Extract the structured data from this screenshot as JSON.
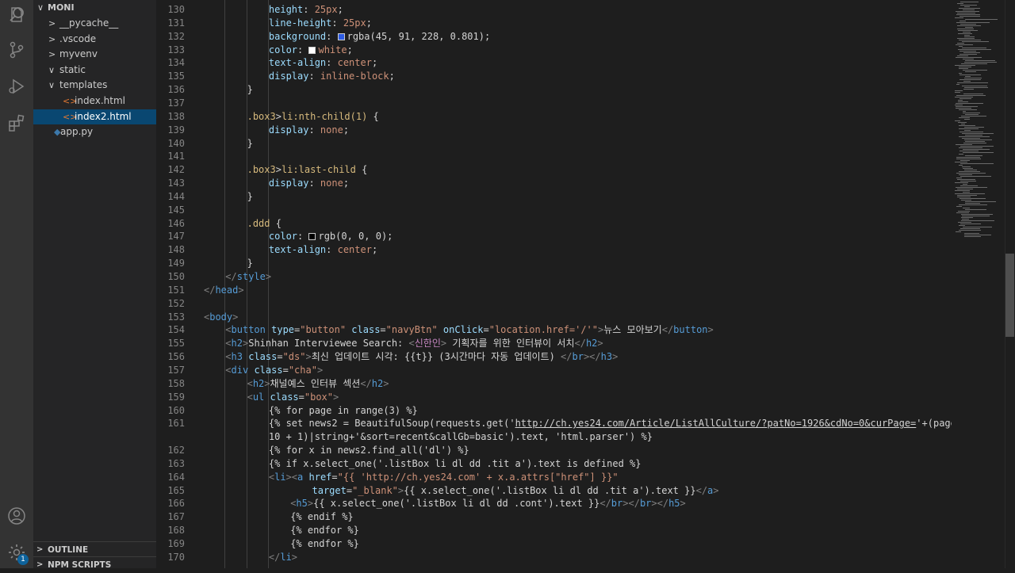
{
  "explorer": {
    "root": "MONI",
    "items": [
      {
        "label": "__pycache__",
        "kind": "folder",
        "open": false
      },
      {
        "label": ".vscode",
        "kind": "folder",
        "open": false
      },
      {
        "label": "myvenv",
        "kind": "folder",
        "open": false
      },
      {
        "label": "static",
        "kind": "folder",
        "open": true
      },
      {
        "label": "templates",
        "kind": "folder",
        "open": true
      },
      {
        "label": "index.html",
        "kind": "html-file",
        "icon": "<>"
      },
      {
        "label": "index2.html",
        "kind": "html-file",
        "icon": "<>",
        "selected": true
      },
      {
        "label": "app.py",
        "kind": "python-file"
      }
    ],
    "sections": [
      "OUTLINE",
      "NPM SCRIPTS"
    ]
  },
  "activity": {
    "icons": [
      "explorer-icon",
      "search-icon",
      "source-control-icon",
      "run-debug-icon",
      "extensions-icon",
      "account-icon",
      "settings-gear-icon"
    ],
    "settings_badge": "1"
  },
  "editor": {
    "lines": [
      {
        "n": "130",
        "indent": 3,
        "tokens": [
          {
            "c": "t-prop",
            "t": "height"
          },
          {
            "c": "t-txt",
            "t": ": "
          },
          {
            "c": "t-val",
            "t": "25px"
          },
          {
            "c": "t-txt",
            "t": ";"
          }
        ]
      },
      {
        "n": "131",
        "indent": 3,
        "tokens": [
          {
            "c": "t-prop",
            "t": "line-height"
          },
          {
            "c": "t-txt",
            "t": ": "
          },
          {
            "c": "t-val",
            "t": "25px"
          },
          {
            "c": "t-txt",
            "t": ";"
          }
        ]
      },
      {
        "n": "132",
        "indent": 3,
        "tokens": [
          {
            "c": "t-prop",
            "t": "background"
          },
          {
            "c": "t-txt",
            "t": ": "
          },
          {
            "swatch": "#2d5be4"
          },
          {
            "c": "t-txt",
            "t": "rgba(45, 91, 228, 0.801)"
          },
          {
            "c": "t-txt",
            "t": ";"
          }
        ]
      },
      {
        "n": "133",
        "indent": 3,
        "tokens": [
          {
            "c": "t-prop",
            "t": "color"
          },
          {
            "c": "t-txt",
            "t": ": "
          },
          {
            "swatch": "#ffffff"
          },
          {
            "c": "t-val",
            "t": "white"
          },
          {
            "c": "t-txt",
            "t": ";"
          }
        ]
      },
      {
        "n": "134",
        "indent": 3,
        "tokens": [
          {
            "c": "t-prop",
            "t": "text-align"
          },
          {
            "c": "t-txt",
            "t": ": "
          },
          {
            "c": "t-val",
            "t": "center"
          },
          {
            "c": "t-txt",
            "t": ";"
          }
        ]
      },
      {
        "n": "135",
        "indent": 3,
        "tokens": [
          {
            "c": "t-prop",
            "t": "display"
          },
          {
            "c": "t-txt",
            "t": ": "
          },
          {
            "c": "t-val",
            "t": "inline-block"
          },
          {
            "c": "t-txt",
            "t": ";"
          }
        ]
      },
      {
        "n": "136",
        "indent": 2,
        "tokens": [
          {
            "c": "t-txt",
            "t": "}"
          }
        ]
      },
      {
        "n": "137",
        "indent": 0,
        "tokens": []
      },
      {
        "n": "138",
        "indent": 2,
        "tokens": [
          {
            "c": "t-sel",
            "t": ".box3"
          },
          {
            "c": "t-txt",
            "t": ">"
          },
          {
            "c": "t-sel",
            "t": "li:nth-child(1)"
          },
          {
            "c": "t-txt",
            "t": " {"
          }
        ]
      },
      {
        "n": "139",
        "indent": 3,
        "tokens": [
          {
            "c": "t-prop",
            "t": "display"
          },
          {
            "c": "t-txt",
            "t": ": "
          },
          {
            "c": "t-val",
            "t": "none"
          },
          {
            "c": "t-txt",
            "t": ";"
          }
        ]
      },
      {
        "n": "140",
        "indent": 2,
        "tokens": [
          {
            "c": "t-txt",
            "t": "}"
          }
        ]
      },
      {
        "n": "141",
        "indent": 0,
        "tokens": []
      },
      {
        "n": "142",
        "indent": 2,
        "tokens": [
          {
            "c": "t-sel",
            "t": ".box3"
          },
          {
            "c": "t-txt",
            "t": ">"
          },
          {
            "c": "t-sel",
            "t": "li:last-child"
          },
          {
            "c": "t-txt",
            "t": " {"
          }
        ]
      },
      {
        "n": "143",
        "indent": 3,
        "tokens": [
          {
            "c": "t-prop",
            "t": "display"
          },
          {
            "c": "t-txt",
            "t": ": "
          },
          {
            "c": "t-val",
            "t": "none"
          },
          {
            "c": "t-txt",
            "t": ";"
          }
        ]
      },
      {
        "n": "144",
        "indent": 2,
        "tokens": [
          {
            "c": "t-txt",
            "t": "}"
          }
        ]
      },
      {
        "n": "145",
        "indent": 0,
        "tokens": []
      },
      {
        "n": "146",
        "indent": 2,
        "tokens": [
          {
            "c": "t-sel",
            "t": ".ddd"
          },
          {
            "c": "t-txt",
            "t": " {"
          }
        ]
      },
      {
        "n": "147",
        "indent": 3,
        "tokens": [
          {
            "c": "t-prop",
            "t": "color"
          },
          {
            "c": "t-txt",
            "t": ": "
          },
          {
            "swatch": "#000000"
          },
          {
            "c": "t-txt",
            "t": "rgb(0, 0, 0)"
          },
          {
            "c": "t-txt",
            "t": ";"
          }
        ]
      },
      {
        "n": "148",
        "indent": 3,
        "tokens": [
          {
            "c": "t-prop",
            "t": "text-align"
          },
          {
            "c": "t-txt",
            "t": ": "
          },
          {
            "c": "t-val",
            "t": "center"
          },
          {
            "c": "t-txt",
            "t": ";"
          }
        ]
      },
      {
        "n": "149",
        "indent": 2,
        "tokens": [
          {
            "c": "t-txt",
            "t": "}"
          }
        ]
      },
      {
        "n": "150",
        "indent": 1,
        "tokens": [
          {
            "c": "t-punc",
            "t": "</"
          },
          {
            "c": "t-tag",
            "t": "style"
          },
          {
            "c": "t-punc",
            "t": ">"
          }
        ]
      },
      {
        "n": "151",
        "indent": 0,
        "tokens": [
          {
            "c": "t-punc",
            "t": "</"
          },
          {
            "c": "t-tag",
            "t": "head"
          },
          {
            "c": "t-punc",
            "t": ">"
          }
        ]
      },
      {
        "n": "152",
        "indent": 0,
        "tokens": []
      },
      {
        "n": "153",
        "indent": 0,
        "tokens": [
          {
            "c": "t-punc",
            "t": "<"
          },
          {
            "c": "t-tag",
            "t": "body"
          },
          {
            "c": "t-punc",
            "t": ">"
          }
        ]
      },
      {
        "n": "154",
        "indent": 1,
        "tokens": [
          {
            "c": "t-punc",
            "t": "<"
          },
          {
            "c": "t-tag",
            "t": "button"
          },
          {
            "c": "t-txt",
            "t": " "
          },
          {
            "c": "t-attr",
            "t": "type"
          },
          {
            "c": "t-txt",
            "t": "="
          },
          {
            "c": "t-str",
            "t": "\"button\""
          },
          {
            "c": "t-txt",
            "t": " "
          },
          {
            "c": "t-attr",
            "t": "class"
          },
          {
            "c": "t-txt",
            "t": "="
          },
          {
            "c": "t-str",
            "t": "\"navyBtn\""
          },
          {
            "c": "t-txt",
            "t": " "
          },
          {
            "c": "t-attr",
            "t": "onClick"
          },
          {
            "c": "t-txt",
            "t": "="
          },
          {
            "c": "t-str",
            "t": "\"location.href='/'\""
          },
          {
            "c": "t-punc",
            "t": ">"
          },
          {
            "c": "t-txt",
            "t": "뉴스 모아보기"
          },
          {
            "c": "t-punc",
            "t": "</"
          },
          {
            "c": "t-tag",
            "t": "button"
          },
          {
            "c": "t-punc",
            "t": ">"
          }
        ]
      },
      {
        "n": "155",
        "indent": 1,
        "tokens": [
          {
            "c": "t-punc",
            "t": "<"
          },
          {
            "c": "t-tag",
            "t": "h2"
          },
          {
            "c": "t-punc",
            "t": ">"
          },
          {
            "c": "t-txt",
            "t": "Shinhan Interviewee Search: "
          },
          {
            "c": "t-punc",
            "t": "<"
          },
          {
            "c": "t-kw",
            "t": "신한인"
          },
          {
            "c": "t-punc",
            "t": ">"
          },
          {
            "c": "t-txt",
            "t": " 기획자를 위한 인터뷰이 서치"
          },
          {
            "c": "t-punc",
            "t": "</"
          },
          {
            "c": "t-tag",
            "t": "h2"
          },
          {
            "c": "t-punc",
            "t": ">"
          }
        ]
      },
      {
        "n": "156",
        "indent": 1,
        "tokens": [
          {
            "c": "t-punc",
            "t": "<"
          },
          {
            "c": "t-tag",
            "t": "h3"
          },
          {
            "c": "t-txt",
            "t": " "
          },
          {
            "c": "t-attr",
            "t": "class"
          },
          {
            "c": "t-txt",
            "t": "="
          },
          {
            "c": "t-str",
            "t": "\"ds\""
          },
          {
            "c": "t-punc",
            "t": ">"
          },
          {
            "c": "t-txt",
            "t": "최신 업데이트 시각: {{t}} (3시간마다 자동 업데이트) "
          },
          {
            "c": "t-punc",
            "t": "</"
          },
          {
            "c": "t-tag",
            "t": "br"
          },
          {
            "c": "t-punc",
            "t": "></"
          },
          {
            "c": "t-tag",
            "t": "h3"
          },
          {
            "c": "t-punc",
            "t": ">"
          }
        ]
      },
      {
        "n": "157",
        "indent": 1,
        "tokens": [
          {
            "c": "t-punc",
            "t": "<"
          },
          {
            "c": "t-tag",
            "t": "div"
          },
          {
            "c": "t-txt",
            "t": " "
          },
          {
            "c": "t-attr",
            "t": "class"
          },
          {
            "c": "t-txt",
            "t": "="
          },
          {
            "c": "t-str",
            "t": "\"cha\""
          },
          {
            "c": "t-punc",
            "t": ">"
          }
        ]
      },
      {
        "n": "158",
        "indent": 2,
        "tokens": [
          {
            "c": "t-punc",
            "t": "<"
          },
          {
            "c": "t-tag",
            "t": "h2"
          },
          {
            "c": "t-punc",
            "t": ">"
          },
          {
            "c": "t-txt",
            "t": "채널예스 인터뷰 섹션"
          },
          {
            "c": "t-punc",
            "t": "</"
          },
          {
            "c": "t-tag",
            "t": "h2"
          },
          {
            "c": "t-punc",
            "t": ">"
          }
        ]
      },
      {
        "n": "159",
        "indent": 2,
        "tokens": [
          {
            "c": "t-punc",
            "t": "<"
          },
          {
            "c": "t-tag",
            "t": "ul"
          },
          {
            "c": "t-txt",
            "t": " "
          },
          {
            "c": "t-attr",
            "t": "class"
          },
          {
            "c": "t-txt",
            "t": "="
          },
          {
            "c": "t-str",
            "t": "\"box\""
          },
          {
            "c": "t-punc",
            "t": ">"
          }
        ]
      },
      {
        "n": "160",
        "indent": 3,
        "tokens": [
          {
            "c": "t-txt",
            "t": "{% for page in range(3) %}"
          }
        ]
      },
      {
        "n": "161",
        "indent": 3,
        "tokens": [
          {
            "c": "t-txt",
            "t": "{% set news2 = BeautifulSoup(requests.get('"
          },
          {
            "c": "t-txt",
            "t": "http://ch.yes24.com/Article/ListAllCulture/?patNo=1926&cdNo=0&curPage=",
            "link": true
          },
          {
            "c": "t-txt",
            "t": "'+(page *"
          }
        ]
      },
      {
        "n": "",
        "indent": 3,
        "tokens": [
          {
            "c": "t-txt",
            "t": "10 + 1)|string+'&sort=recent&callGb=basic').text, 'html.parser') %}"
          }
        ]
      },
      {
        "n": "162",
        "indent": 3,
        "tokens": [
          {
            "c": "t-txt",
            "t": "{% for x in news2.find_all('dl') %}"
          }
        ]
      },
      {
        "n": "163",
        "indent": 3,
        "tokens": [
          {
            "c": "t-txt",
            "t": "{% if x.select_one('.listBox li dl dd .tit a').text is defined %}"
          }
        ]
      },
      {
        "n": "164",
        "indent": 3,
        "tokens": [
          {
            "c": "t-punc",
            "t": "<"
          },
          {
            "c": "t-tag",
            "t": "li"
          },
          {
            "c": "t-punc",
            "t": "><"
          },
          {
            "c": "t-tag",
            "t": "a"
          },
          {
            "c": "t-txt",
            "t": " "
          },
          {
            "c": "t-attr",
            "t": "href"
          },
          {
            "c": "t-txt",
            "t": "="
          },
          {
            "c": "t-str",
            "t": "\"{{ 'http://ch.yes24.com' + x.a.attrs[\"href\"] }}\""
          }
        ]
      },
      {
        "n": "165",
        "indent": 5,
        "tokens": [
          {
            "c": "t-attr",
            "t": "target"
          },
          {
            "c": "t-txt",
            "t": "="
          },
          {
            "c": "t-str",
            "t": "\"_blank\""
          },
          {
            "c": "t-punc",
            "t": ">"
          },
          {
            "c": "t-txt",
            "t": "{{ x.select_one('.listBox li dl dd .tit a').text }}"
          },
          {
            "c": "t-punc",
            "t": "</"
          },
          {
            "c": "t-tag",
            "t": "a"
          },
          {
            "c": "t-punc",
            "t": ">"
          }
        ]
      },
      {
        "n": "166",
        "indent": 4,
        "tokens": [
          {
            "c": "t-punc",
            "t": "<"
          },
          {
            "c": "t-tag",
            "t": "h5"
          },
          {
            "c": "t-punc",
            "t": ">"
          },
          {
            "c": "t-txt",
            "t": "{{ x.select_one('.listBox li dl dd .cont').text }}"
          },
          {
            "c": "t-punc",
            "t": "</"
          },
          {
            "c": "t-tag",
            "t": "br"
          },
          {
            "c": "t-punc",
            "t": "></"
          },
          {
            "c": "t-tag",
            "t": "br"
          },
          {
            "c": "t-punc",
            "t": "></"
          },
          {
            "c": "t-tag",
            "t": "h5"
          },
          {
            "c": "t-punc",
            "t": ">"
          }
        ]
      },
      {
        "n": "167",
        "indent": 4,
        "tokens": [
          {
            "c": "t-txt",
            "t": "{% endif %}"
          }
        ]
      },
      {
        "n": "168",
        "indent": 4,
        "tokens": [
          {
            "c": "t-txt",
            "t": "{% endfor %}"
          }
        ]
      },
      {
        "n": "169",
        "indent": 4,
        "tokens": [
          {
            "c": "t-txt",
            "t": "{% endfor %}"
          }
        ]
      },
      {
        "n": "170",
        "indent": 3,
        "tokens": [
          {
            "c": "t-punc",
            "t": "</"
          },
          {
            "c": "t-tag",
            "t": "li"
          },
          {
            "c": "t-punc",
            "t": ">"
          }
        ]
      }
    ]
  },
  "colors": {
    "activity_bg": "#333333",
    "sidebar_bg": "#252526",
    "editor_bg": "#1e1e1e",
    "selection": "#094771",
    "accent": "#0e639c"
  }
}
